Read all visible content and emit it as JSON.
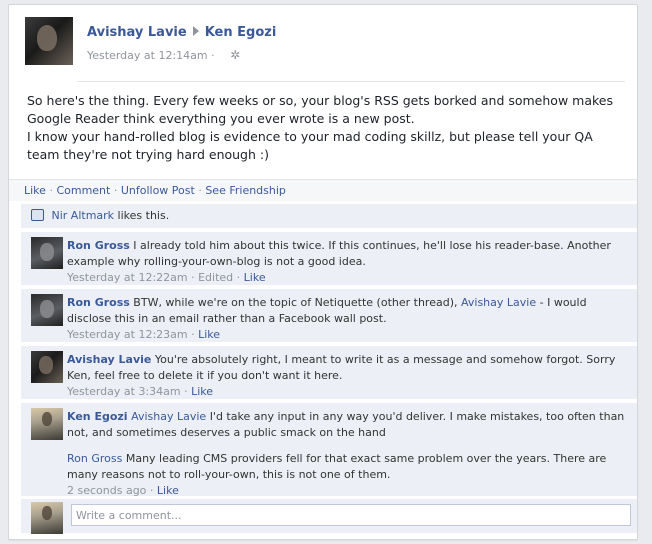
{
  "post": {
    "author": "Avishay Lavie",
    "recipient": "Ken Egozi",
    "timestamp": "Yesterday at 12:14am",
    "text_p1": "So here's the thing. Every few weeks or so, your blog's RSS gets borked and somehow makes Google Reader think everything you ever wrote is a new post.",
    "text_p2": "I know your hand-rolled blog is evidence to your mad coding skillz, but please tell your QA team they're not trying hard enough :)"
  },
  "actions": {
    "like": "Like",
    "comment": "Comment",
    "unfollow": "Unfollow Post",
    "see_friendship": "See Friendship",
    "separator": "·"
  },
  "likes": {
    "name": "Nir Altmark",
    "suffix": "likes this."
  },
  "comments": [
    {
      "author": "Ron Gross",
      "text": "I already told him about this twice. If this continues, he'll lose his reader-base. Another example why rolling-your-own-blog is not a good idea.",
      "time": "Yesterday at 12:22am",
      "edited": "Edited",
      "like": "Like"
    },
    {
      "author": "Ron Gross",
      "text_before": "BTW, while we're on the topic of Netiquette (other thread),",
      "mention": "Avishay Lavie",
      "text_after": "- I would disclose this in an email rather than a Facebook wall post.",
      "time": "Yesterday at 12:23am",
      "like": "Like"
    },
    {
      "author": "Avishay Lavie",
      "text": "You're absolutely right, I meant to write it as a message and somehow forgot. Sorry Ken, feel free to delete it if you don't want it here.",
      "time": "Yesterday at 3:34am",
      "like": "Like"
    },
    {
      "author": "Ken Egozi",
      "mention": "Avishay Lavie",
      "text": "I'd take any input in any way you'd deliver. I make mistakes, too often than not, and sometimes deserves a public smack on the hand",
      "mention2": "Ron Gross",
      "text2": "Many leading CMS providers fell for that exact same problem over the years. There are many reasons not to roll-your-own, this is not one of them.",
      "time": "2 seconds ago",
      "like": "Like"
    }
  ],
  "composer": {
    "placeholder": "Write a comment..."
  },
  "icons": {
    "settings": "gear-icon",
    "like": "thumbs-up-icon",
    "arrow": "right-arrow-icon"
  },
  "colors": {
    "link": "#3b5998",
    "meta": "#90949c",
    "panel": "#eceff5"
  }
}
